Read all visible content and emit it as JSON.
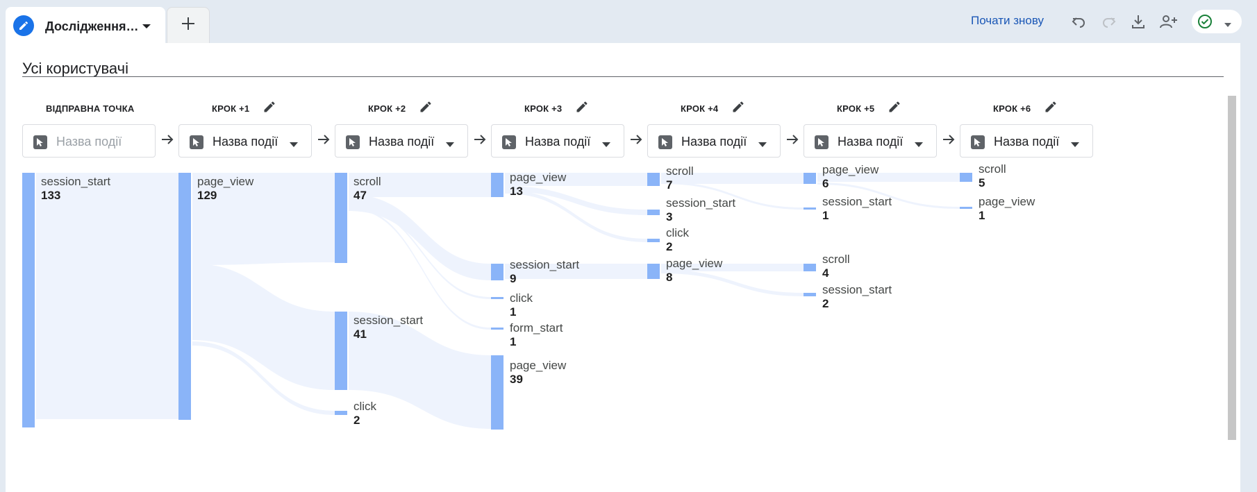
{
  "tab": {
    "title": "Дослідження…",
    "add_label": "+"
  },
  "toolbar": {
    "restart_label": "Почати знову"
  },
  "icons": [
    "pencil-icon",
    "chevron-down-icon",
    "plus-icon",
    "undo-icon",
    "redo-icon",
    "download-icon",
    "share-user-icon",
    "check-circle-icon",
    "cursor-icon",
    "arrow-right-icon"
  ],
  "colors": {
    "accent": "#1a73e8",
    "bar": "#8ab4f8",
    "flow": "#eef3fd",
    "ok": "#188038"
  },
  "segment": {
    "title": "Усі користувачі"
  },
  "steps": [
    {
      "head": "ВІДПРАВНА ТОЧКА",
      "dropdown": "Назва події",
      "placeholder": true
    },
    {
      "head": "КРОК +1",
      "dropdown": "Назва події"
    },
    {
      "head": "КРОК +2",
      "dropdown": "Назва події"
    },
    {
      "head": "КРОК +3",
      "dropdown": "Назва події"
    },
    {
      "head": "КРОК +4",
      "dropdown": "Назва події"
    },
    {
      "head": "КРОК +5",
      "dropdown": "Назва події"
    },
    {
      "head": "КРОК +6",
      "dropdown": "Назва події"
    }
  ],
  "nodes": [
    [
      {
        "name": "session_start",
        "value": "133"
      }
    ],
    [
      {
        "name": "page_view",
        "value": "129"
      }
    ],
    [
      {
        "name": "scroll",
        "value": "47"
      },
      {
        "name": "session_start",
        "value": "41"
      },
      {
        "name": "click",
        "value": "2"
      }
    ],
    [
      {
        "name": "page_view",
        "value": "13"
      },
      {
        "name": "session_start",
        "value": "9"
      },
      {
        "name": "click",
        "value": "1"
      },
      {
        "name": "form_start",
        "value": "1"
      },
      {
        "name": "page_view",
        "value": "39"
      }
    ],
    [
      {
        "name": "scroll",
        "value": "7"
      },
      {
        "name": "session_start",
        "value": "3"
      },
      {
        "name": "click",
        "value": "2"
      },
      {
        "name": "page_view",
        "value": "8"
      }
    ],
    [
      {
        "name": "page_view",
        "value": "6"
      },
      {
        "name": "session_start",
        "value": "1"
      },
      {
        "name": "scroll",
        "value": "4"
      },
      {
        "name": "session_start",
        "value": "2"
      }
    ],
    [
      {
        "name": "scroll",
        "value": "5"
      },
      {
        "name": "page_view",
        "value": "1"
      }
    ]
  ]
}
